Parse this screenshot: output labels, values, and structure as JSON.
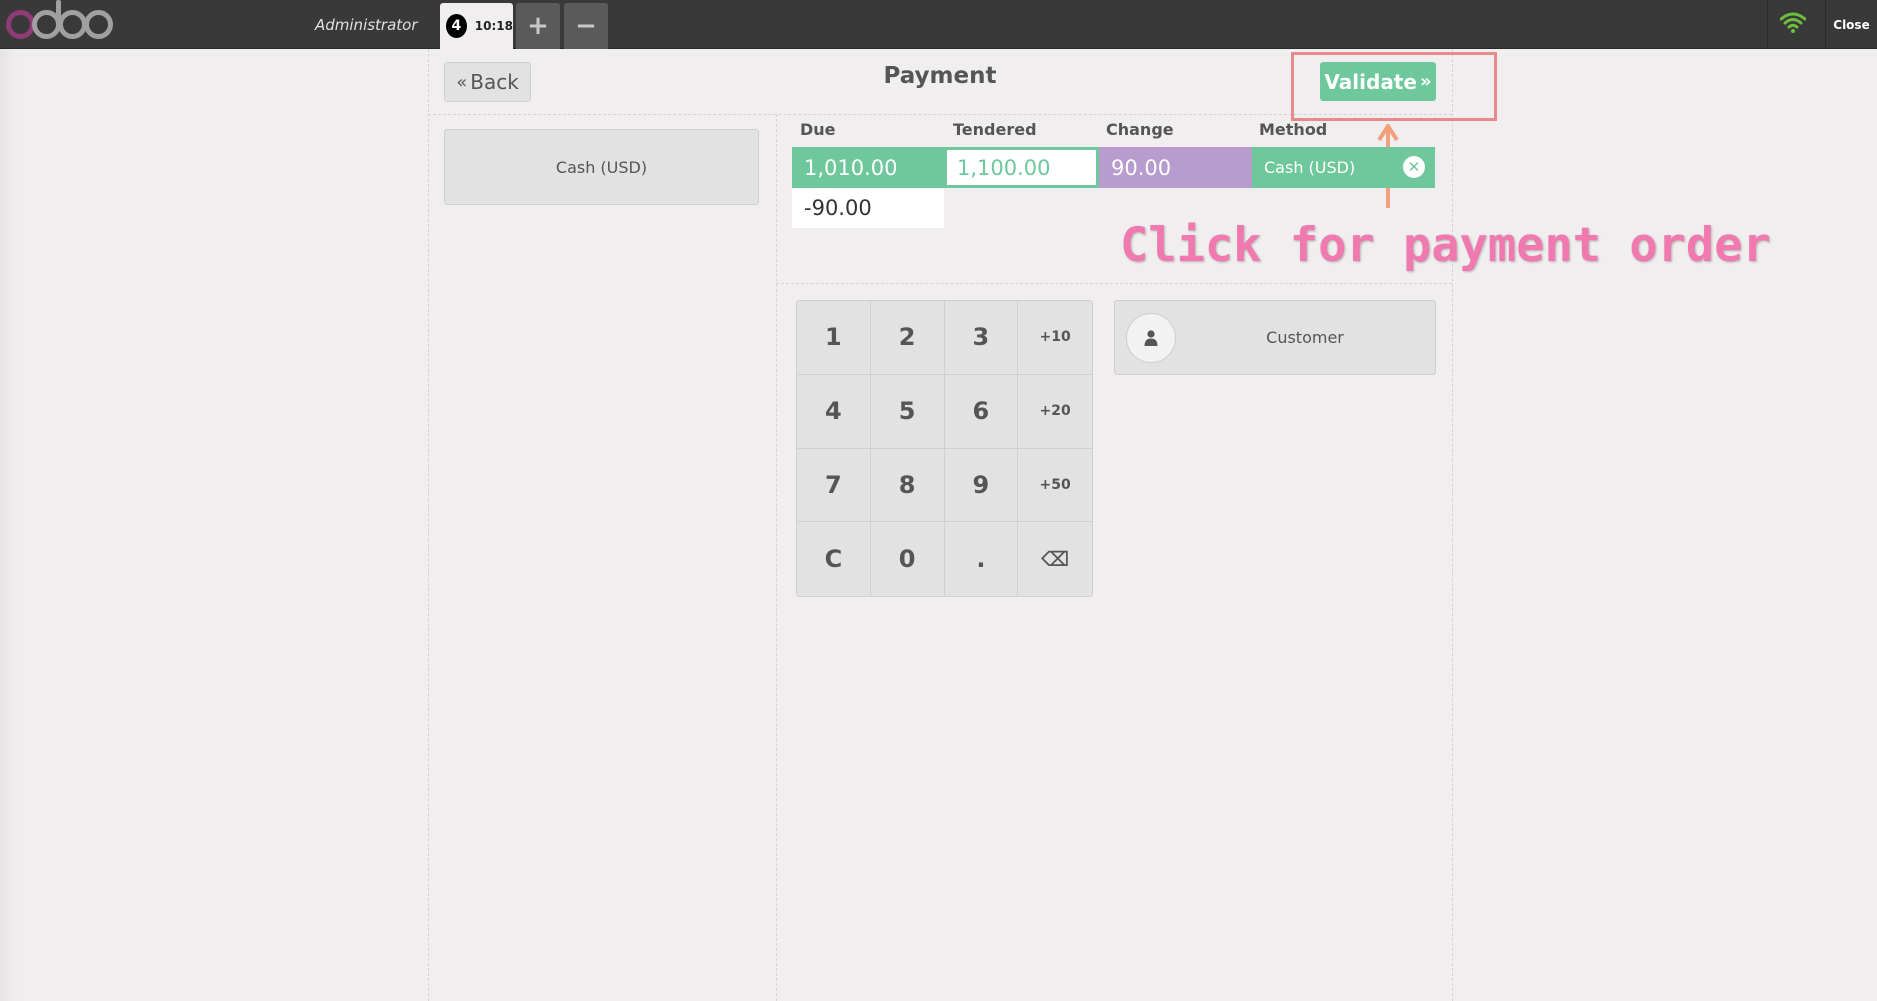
{
  "topbar": {
    "user": "Administrator",
    "order_number": "4",
    "order_time": "10:18",
    "add_order": "+",
    "remove_order": "−",
    "close": "Close"
  },
  "header": {
    "back_label": "Back",
    "title": "Payment",
    "validate_label": "Validate"
  },
  "payment_methods": [
    {
      "label": "Cash (USD)"
    }
  ],
  "payment_lines": {
    "columns": {
      "due": "Due",
      "tendered": "Tendered",
      "change": "Change",
      "method": "Method"
    },
    "rows": [
      {
        "due": "1,010.00",
        "tendered": "1,100.00",
        "change": "90.00",
        "method": "Cash (USD)"
      }
    ],
    "remaining": "-90.00"
  },
  "numpad": {
    "keys": [
      "1",
      "2",
      "3",
      "+10",
      "4",
      "5",
      "6",
      "+20",
      "7",
      "8",
      "9",
      "+50",
      "C",
      "0",
      ".",
      "⌫"
    ]
  },
  "customer": {
    "label": "Customer"
  },
  "annotation": {
    "text": "Click for payment order"
  },
  "colors": {
    "topbar": "#393939",
    "accent_green": "#6ec89b",
    "change_purple": "#b89ccd",
    "annotation_pink": "#f07ab0",
    "highlight_red": "#e98a8a",
    "arrow_orange": "#f0a07c"
  },
  "icons": {
    "logo": "odoo-logo",
    "wifi": "wifi-icon",
    "remove": "remove-circle-icon",
    "customer": "user-icon",
    "backspace": "backspace-icon"
  }
}
